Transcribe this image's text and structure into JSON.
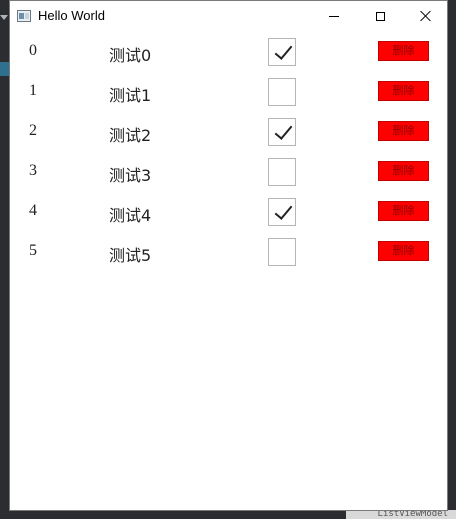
{
  "window": {
    "title": "Hello World"
  },
  "rows": [
    {
      "id": "0",
      "name": "测试0",
      "checked": true,
      "delete_label": "删除"
    },
    {
      "id": "1",
      "name": "测试1",
      "checked": false,
      "delete_label": "删除"
    },
    {
      "id": "2",
      "name": "测试2",
      "checked": true,
      "delete_label": "删除"
    },
    {
      "id": "3",
      "name": "测试3",
      "checked": false,
      "delete_label": "删除"
    },
    {
      "id": "4",
      "name": "测试4",
      "checked": true,
      "delete_label": "删除"
    },
    {
      "id": "5",
      "name": "测试5",
      "checked": false,
      "delete_label": "删除"
    }
  ],
  "background": {
    "strip_text": "ListViewModel"
  },
  "colors": {
    "delete_button": "#ff0000",
    "window_background": "#ffffff"
  }
}
